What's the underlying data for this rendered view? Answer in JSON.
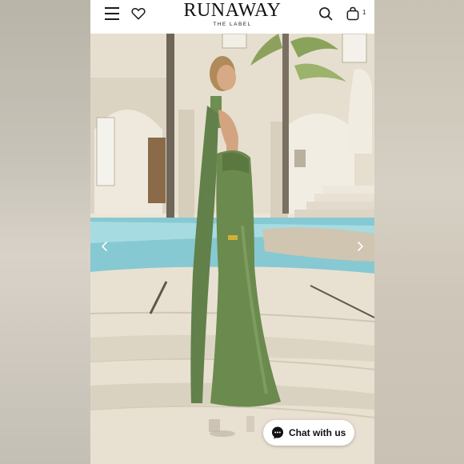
{
  "header": {
    "logo_main": "RUNAWAY",
    "logo_sub": "THE LABEL",
    "cart_count": "1"
  },
  "chat": {
    "label": "Chat with us"
  },
  "colors": {
    "dress": "#6b8a4e",
    "pool": "#86c9d2",
    "stone": "#e8e1d2"
  },
  "icons": [
    "menu-icon",
    "heart-icon",
    "search-icon",
    "cart-icon",
    "chevron-left-icon",
    "chevron-right-icon",
    "chat-bubble-icon"
  ]
}
